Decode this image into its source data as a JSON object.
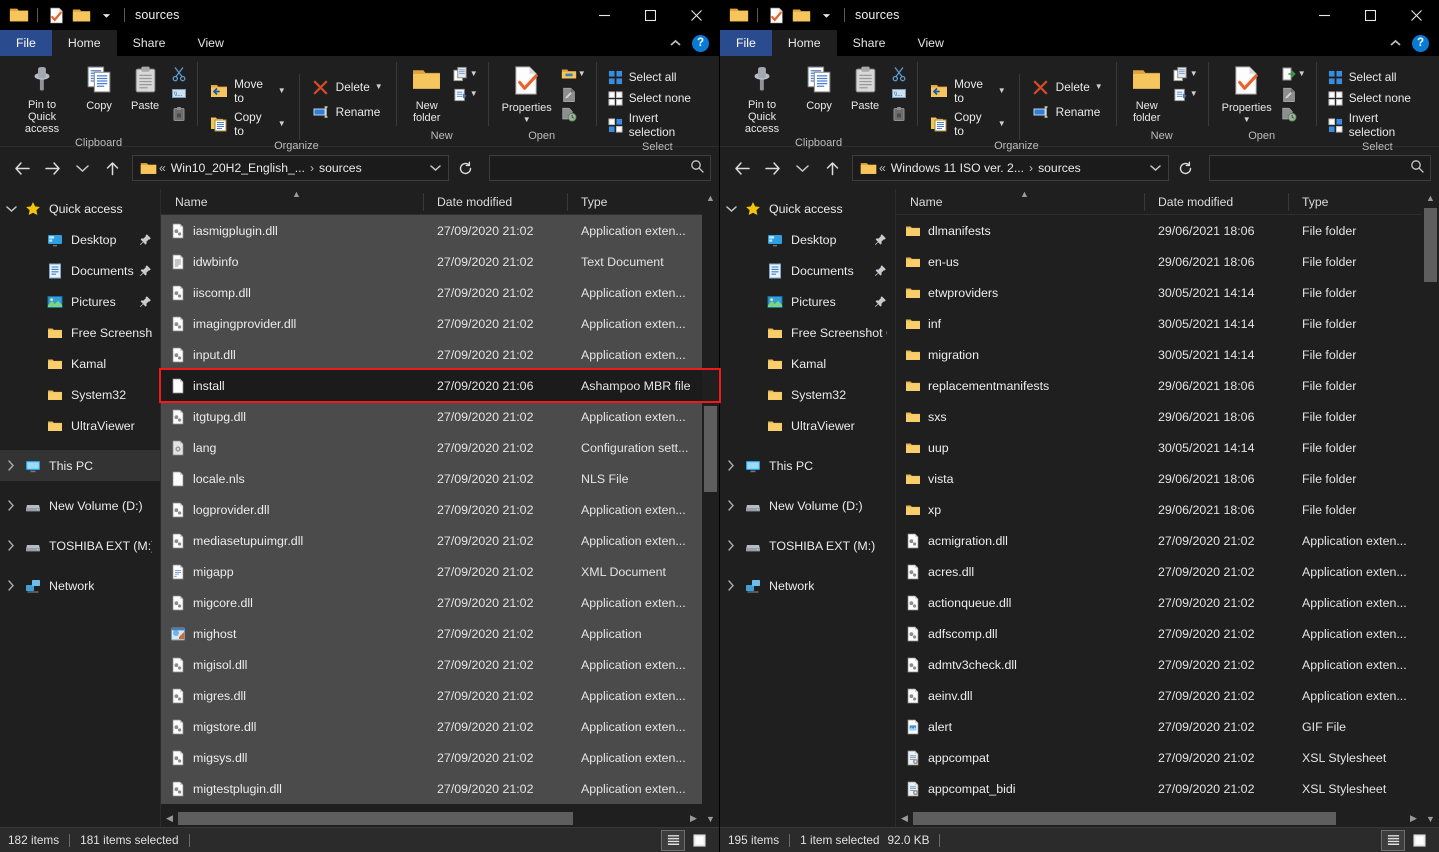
{
  "windows": [
    {
      "key": "left",
      "titlebar": {
        "title": "sources",
        "qat_icons": [
          "folder-icon",
          "properties-icon",
          "new-folder-icon",
          "dropdown-icon"
        ]
      },
      "controls": {
        "minimize": "–",
        "maximize": "□",
        "close": "✕"
      },
      "tabs": [
        {
          "label": "File",
          "kind": "file"
        },
        {
          "label": "Home",
          "kind": "active"
        },
        {
          "label": "Share",
          "kind": "normal"
        },
        {
          "label": "View",
          "kind": "normal"
        }
      ],
      "ribbon": {
        "clipboard": {
          "label": "Clipboard",
          "pin": "Pin to Quick\naccess",
          "copy": "Copy",
          "paste": "Paste",
          "cut_icon": "scissors-icon",
          "copy_path_icon": "copy-path-icon",
          "paste_shortcut_icon": "paste-shortcut-icon"
        },
        "organize": {
          "label": "Organize",
          "move_to": "Move to",
          "copy_to": "Copy to",
          "delete": "Delete",
          "rename": "Rename"
        },
        "new": {
          "label": "New",
          "new_folder": "New\nfolder",
          "new_item_icon": "new-item-icon",
          "easy_access_icon": "easy-access-icon"
        },
        "open": {
          "label": "Open",
          "properties": "Properties",
          "open_icon": "open-with-icon",
          "edit_icon": "edit-icon",
          "history_icon": "history-icon"
        },
        "select": {
          "label": "Select",
          "select_all": "Select all",
          "select_none": "Select none",
          "invert": "Invert selection"
        }
      },
      "address": {
        "root_icon": "folder-icon",
        "crumb_prefix": "«",
        "crumbs": [
          "Win10_20H2_English_...",
          "sources"
        ],
        "search_placeholder": ""
      },
      "nav": [
        {
          "label": "Quick access",
          "icon": "star-icon",
          "expander": "down",
          "indent": 0,
          "pin": false,
          "selected": false
        },
        {
          "label": "Desktop",
          "icon": "desktop-icon",
          "expander": "",
          "indent": 1,
          "pin": true,
          "selected": false
        },
        {
          "label": "Documents",
          "icon": "documents-icon",
          "expander": "",
          "indent": 1,
          "pin": true,
          "selected": false
        },
        {
          "label": "Pictures",
          "icon": "pictures-icon",
          "expander": "",
          "indent": 1,
          "pin": true,
          "selected": false
        },
        {
          "label": "Free Screenshot Ca",
          "icon": "folder-icon",
          "expander": "",
          "indent": 1,
          "pin": false,
          "selected": false
        },
        {
          "label": "Kamal",
          "icon": "folder-icon",
          "expander": "",
          "indent": 1,
          "pin": false,
          "selected": false
        },
        {
          "label": "System32",
          "icon": "folder-icon",
          "expander": "",
          "indent": 1,
          "pin": false,
          "selected": false
        },
        {
          "label": "UltraViewer",
          "icon": "folder-icon",
          "expander": "",
          "indent": 1,
          "pin": false,
          "selected": false
        },
        {
          "label": "This PC",
          "icon": "pc-icon",
          "expander": "right",
          "indent": 0,
          "pin": false,
          "selected": true,
          "gap": true
        },
        {
          "label": "New Volume (D:)",
          "icon": "drive-icon",
          "expander": "right",
          "indent": 0,
          "pin": false,
          "selected": false,
          "gap": true
        },
        {
          "label": "TOSHIBA EXT (M:)",
          "icon": "drive-icon",
          "expander": "right",
          "indent": 0,
          "pin": false,
          "selected": false,
          "gap": true
        },
        {
          "label": "Network",
          "icon": "network-icon",
          "expander": "right",
          "indent": 0,
          "pin": false,
          "selected": false,
          "gap": true
        }
      ],
      "columns": {
        "name": "Name",
        "date": "Date modified",
        "type": "Type"
      },
      "rows": [
        {
          "name": "iasmigplugin.dll",
          "date": "27/09/2020 21:02",
          "type": "Application exten...",
          "icon": "dll-icon",
          "state": "sel"
        },
        {
          "name": "idwbinfo",
          "date": "27/09/2020 21:02",
          "type": "Text Document",
          "icon": "text-icon",
          "state": "sel"
        },
        {
          "name": "iiscomp.dll",
          "date": "27/09/2020 21:02",
          "type": "Application exten...",
          "icon": "dll-icon",
          "state": "sel"
        },
        {
          "name": "imagingprovider.dll",
          "date": "27/09/2020 21:02",
          "type": "Application exten...",
          "icon": "dll-icon",
          "state": "sel"
        },
        {
          "name": "input.dll",
          "date": "27/09/2020 21:02",
          "type": "Application exten...",
          "icon": "dll-icon",
          "state": "sel"
        },
        {
          "name": "install",
          "date": "27/09/2020 21:06",
          "type": "Ashampoo MBR file",
          "icon": "blank-file-icon",
          "state": "focus"
        },
        {
          "name": "itgtupg.dll",
          "date": "27/09/2020 21:02",
          "type": "Application exten...",
          "icon": "dll-icon",
          "state": "sel"
        },
        {
          "name": "lang",
          "date": "27/09/2020 21:02",
          "type": "Configuration sett...",
          "icon": "config-icon",
          "state": "sel"
        },
        {
          "name": "locale.nls",
          "date": "27/09/2020 21:02",
          "type": "NLS File",
          "icon": "blank-file-icon",
          "state": "sel"
        },
        {
          "name": "logprovider.dll",
          "date": "27/09/2020 21:02",
          "type": "Application exten...",
          "icon": "dll-icon",
          "state": "sel"
        },
        {
          "name": "mediasetupuimgr.dll",
          "date": "27/09/2020 21:02",
          "type": "Application exten...",
          "icon": "dll-icon",
          "state": "sel"
        },
        {
          "name": "migapp",
          "date": "27/09/2020 21:02",
          "type": "XML Document",
          "icon": "xml-icon",
          "state": "sel"
        },
        {
          "name": "migcore.dll",
          "date": "27/09/2020 21:02",
          "type": "Application exten...",
          "icon": "dll-icon",
          "state": "sel"
        },
        {
          "name": "mighost",
          "date": "27/09/2020 21:02",
          "type": "Application",
          "icon": "exe-icon",
          "state": "sel"
        },
        {
          "name": "migisol.dll",
          "date": "27/09/2020 21:02",
          "type": "Application exten...",
          "icon": "dll-icon",
          "state": "sel"
        },
        {
          "name": "migres.dll",
          "date": "27/09/2020 21:02",
          "type": "Application exten...",
          "icon": "dll-icon",
          "state": "sel"
        },
        {
          "name": "migstore.dll",
          "date": "27/09/2020 21:02",
          "type": "Application exten...",
          "icon": "dll-icon",
          "state": "sel"
        },
        {
          "name": "migsys.dll",
          "date": "27/09/2020 21:02",
          "type": "Application exten...",
          "icon": "dll-icon",
          "state": "sel"
        },
        {
          "name": "migtestplugin.dll",
          "date": "27/09/2020 21:02",
          "type": "Application exten...",
          "icon": "dll-icon",
          "state": "sel"
        }
      ],
      "status": {
        "items": "182 items",
        "selected": "181 items selected",
        "size": ""
      }
    },
    {
      "key": "right",
      "titlebar": {
        "title": "sources",
        "qat_icons": [
          "folder-icon",
          "properties-icon",
          "new-folder-icon",
          "dropdown-icon"
        ]
      },
      "controls": {
        "minimize": "–",
        "maximize": "□",
        "close": "✕"
      },
      "tabs": [
        {
          "label": "File",
          "kind": "file"
        },
        {
          "label": "Home",
          "kind": "active"
        },
        {
          "label": "Share",
          "kind": "normal"
        },
        {
          "label": "View",
          "kind": "normal"
        }
      ],
      "ribbon": {
        "clipboard": {
          "label": "Clipboard",
          "pin": "Pin to Quick\naccess",
          "copy": "Copy",
          "paste": "Paste",
          "cut_icon": "scissors-icon",
          "copy_path_icon": "copy-path-icon",
          "paste_shortcut_icon": "paste-shortcut-icon"
        },
        "organize": {
          "label": "Organize",
          "move_to": "Move to",
          "copy_to": "Copy to",
          "delete": "Delete",
          "rename": "Rename"
        },
        "new": {
          "label": "New",
          "new_folder": "New\nfolder",
          "new_item_icon": "new-item-icon",
          "easy_access_icon": "easy-access-icon"
        },
        "open": {
          "label": "Open",
          "properties": "Properties",
          "open_icon": "open-with-icon",
          "edit_icon": "edit-icon",
          "history_icon": "history-icon"
        },
        "select": {
          "label": "Select",
          "select_all": "Select all",
          "select_none": "Select none",
          "invert": "Invert selection"
        }
      },
      "address": {
        "root_icon": "folder-icon",
        "crumb_prefix": "«",
        "crumbs": [
          "Windows 11 ISO ver. 2...",
          "sources"
        ],
        "search_placeholder": ""
      },
      "nav": [
        {
          "label": "Quick access",
          "icon": "star-icon",
          "expander": "down",
          "indent": 0,
          "pin": false,
          "selected": false
        },
        {
          "label": "Desktop",
          "icon": "desktop-icon",
          "expander": "",
          "indent": 1,
          "pin": true,
          "selected": false
        },
        {
          "label": "Documents",
          "icon": "documents-icon",
          "expander": "",
          "indent": 1,
          "pin": true,
          "selected": false
        },
        {
          "label": "Pictures",
          "icon": "pictures-icon",
          "expander": "",
          "indent": 1,
          "pin": true,
          "selected": false
        },
        {
          "label": "Free Screenshot Ca",
          "icon": "folder-icon",
          "expander": "",
          "indent": 1,
          "pin": false,
          "selected": false
        },
        {
          "label": "Kamal",
          "icon": "folder-icon",
          "expander": "",
          "indent": 1,
          "pin": false,
          "selected": false
        },
        {
          "label": "System32",
          "icon": "folder-icon",
          "expander": "",
          "indent": 1,
          "pin": false,
          "selected": false
        },
        {
          "label": "UltraViewer",
          "icon": "folder-icon",
          "expander": "",
          "indent": 1,
          "pin": false,
          "selected": false
        },
        {
          "label": "This PC",
          "icon": "pc-icon",
          "expander": "right",
          "indent": 0,
          "pin": false,
          "selected": false,
          "gap": true
        },
        {
          "label": "New Volume (D:)",
          "icon": "drive-icon",
          "expander": "right",
          "indent": 0,
          "pin": false,
          "selected": false,
          "gap": true
        },
        {
          "label": "TOSHIBA EXT (M:)",
          "icon": "drive-icon",
          "expander": "right",
          "indent": 0,
          "pin": false,
          "selected": false,
          "gap": true
        },
        {
          "label": "Network",
          "icon": "network-icon",
          "expander": "right",
          "indent": 0,
          "pin": false,
          "selected": false,
          "gap": true
        }
      ],
      "columns": {
        "name": "Name",
        "date": "Date modified",
        "type": "Type"
      },
      "rows": [
        {
          "name": "dlmanifests",
          "date": "29/06/2021 18:06",
          "type": "File folder",
          "icon": "folder-icon",
          "state": ""
        },
        {
          "name": "en-us",
          "date": "29/06/2021 18:06",
          "type": "File folder",
          "icon": "folder-icon",
          "state": ""
        },
        {
          "name": "etwproviders",
          "date": "30/05/2021 14:14",
          "type": "File folder",
          "icon": "folder-icon",
          "state": ""
        },
        {
          "name": "inf",
          "date": "30/05/2021 14:14",
          "type": "File folder",
          "icon": "folder-icon",
          "state": ""
        },
        {
          "name": "migration",
          "date": "30/05/2021 14:14",
          "type": "File folder",
          "icon": "folder-icon",
          "state": ""
        },
        {
          "name": "replacementmanifests",
          "date": "29/06/2021 18:06",
          "type": "File folder",
          "icon": "folder-icon",
          "state": ""
        },
        {
          "name": "sxs",
          "date": "29/06/2021 18:06",
          "type": "File folder",
          "icon": "folder-icon",
          "state": ""
        },
        {
          "name": "uup",
          "date": "30/05/2021 14:14",
          "type": "File folder",
          "icon": "folder-icon",
          "state": ""
        },
        {
          "name": "vista",
          "date": "29/06/2021 18:06",
          "type": "File folder",
          "icon": "folder-icon",
          "state": ""
        },
        {
          "name": "xp",
          "date": "29/06/2021 18:06",
          "type": "File folder",
          "icon": "folder-icon",
          "state": ""
        },
        {
          "name": "acmigration.dll",
          "date": "27/09/2020 21:02",
          "type": "Application exten...",
          "icon": "dll-icon",
          "state": ""
        },
        {
          "name": "acres.dll",
          "date": "27/09/2020 21:02",
          "type": "Application exten...",
          "icon": "dll-icon",
          "state": ""
        },
        {
          "name": "actionqueue.dll",
          "date": "27/09/2020 21:02",
          "type": "Application exten...",
          "icon": "dll-icon",
          "state": ""
        },
        {
          "name": "adfscomp.dll",
          "date": "27/09/2020 21:02",
          "type": "Application exten...",
          "icon": "dll-icon",
          "state": ""
        },
        {
          "name": "admtv3check.dll",
          "date": "27/09/2020 21:02",
          "type": "Application exten...",
          "icon": "dll-icon",
          "state": ""
        },
        {
          "name": "aeinv.dll",
          "date": "27/09/2020 21:02",
          "type": "Application exten...",
          "icon": "dll-icon",
          "state": ""
        },
        {
          "name": "alert",
          "date": "27/09/2020 21:02",
          "type": "GIF File",
          "icon": "gif-icon",
          "state": ""
        },
        {
          "name": "appcompat",
          "date": "27/09/2020 21:02",
          "type": "XSL Stylesheet",
          "icon": "xsl-icon",
          "state": ""
        },
        {
          "name": "appcompat_bidi",
          "date": "27/09/2020 21:02",
          "type": "XSL Stylesheet",
          "icon": "xsl-icon",
          "state": ""
        }
      ],
      "status": {
        "items": "195 items",
        "selected": "1 item selected",
        "size": "92.0 KB"
      }
    }
  ],
  "statusbar_view_icons": {
    "details": "details-view-icon",
    "large": "large-icons-view-icon"
  },
  "colors": {
    "accent_blue": "#2b4b8f",
    "highlight_red": "#ef1b1b",
    "folder_yellow": "#f5c24b",
    "help_blue": "#0a7bd4"
  }
}
